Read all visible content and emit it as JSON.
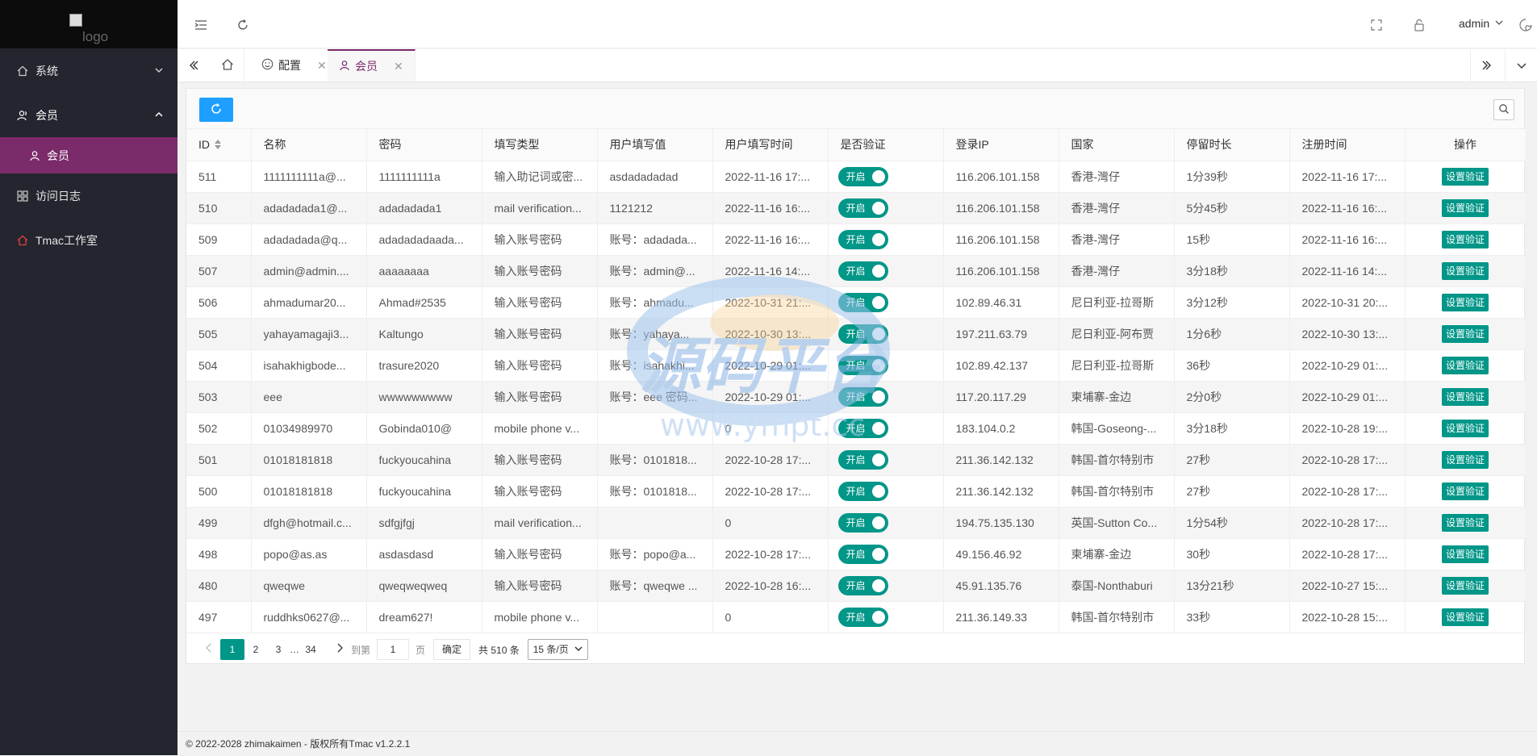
{
  "sidebar": {
    "logo_alt": "logo",
    "items": [
      {
        "label": "系统",
        "icon": "home-icon"
      },
      {
        "label": "会员",
        "icon": "user-group-icon"
      },
      {
        "label": "访问日志",
        "icon": "grid-icon"
      },
      {
        "label": "Tmac工作室",
        "icon": "home-icon"
      }
    ],
    "sub_items": [
      {
        "label": "会员",
        "icon": "user-icon"
      }
    ]
  },
  "header": {
    "user": "admin"
  },
  "tabs": [
    {
      "label": "配置"
    },
    {
      "label": "会员"
    }
  ],
  "table": {
    "columns": [
      "ID",
      "名称",
      "密码",
      "填写类型",
      "用户填写值",
      "用户填写时间",
      "是否验证",
      "登录IP",
      "国家",
      "停留时长",
      "注册时间",
      "操作"
    ],
    "switch_label": "开启",
    "action_label": "设置验证",
    "rows": [
      {
        "id": "511",
        "name": "1111111111a@...",
        "pwd": "1111111111a",
        "type": "输入助记词或密...",
        "value": "asdadadadad",
        "vtime": "2022-11-16 17:...",
        "ip": "116.206.101.158",
        "country": "香港-灣仔",
        "stay": "1分39秒",
        "reg": "2022-11-16 17:..."
      },
      {
        "id": "510",
        "name": "adadadada1@...",
        "pwd": "adadadada1",
        "type": "mail verification...",
        "value": "1121212",
        "vtime": "2022-11-16 16:...",
        "ip": "116.206.101.158",
        "country": "香港-灣仔",
        "stay": "5分45秒",
        "reg": "2022-11-16 16:..."
      },
      {
        "id": "509",
        "name": "adadadada@q...",
        "pwd": "adadadadaada...",
        "type": "输入账号密码",
        "value": "账号：adadada...",
        "vtime": "2022-11-16 16:...",
        "ip": "116.206.101.158",
        "country": "香港-灣仔",
        "stay": "15秒",
        "reg": "2022-11-16 16:..."
      },
      {
        "id": "507",
        "name": "admin@admin....",
        "pwd": "aaaaaaaa",
        "type": "输入账号密码",
        "value": "账号：admin@...",
        "vtime": "2022-11-16 14:...",
        "ip": "116.206.101.158",
        "country": "香港-灣仔",
        "stay": "3分18秒",
        "reg": "2022-11-16 14:..."
      },
      {
        "id": "506",
        "name": "ahmadumar20...",
        "pwd": "Ahmad#2535",
        "type": "输入账号密码",
        "value": "账号：ahmadu...",
        "vtime": "2022-10-31 21:...",
        "ip": "102.89.46.31",
        "country": "尼日利亚-拉哥斯",
        "stay": "3分12秒",
        "reg": "2022-10-31 20:..."
      },
      {
        "id": "505",
        "name": "yahayamagaji3...",
        "pwd": "Kaltungo",
        "type": "输入账号密码",
        "value": "账号：yahaya...",
        "vtime": "2022-10-30 13:...",
        "ip": "197.211.63.79",
        "country": "尼日利亚-阿布贾",
        "stay": "1分6秒",
        "reg": "2022-10-30 13:..."
      },
      {
        "id": "504",
        "name": "isahakhigbode...",
        "pwd": "trasure2020",
        "type": "输入账号密码",
        "value": "账号：isahakhi...",
        "vtime": "2022-10-29 01:...",
        "ip": "102.89.42.137",
        "country": "尼日利亚-拉哥斯",
        "stay": "36秒",
        "reg": "2022-10-29 01:..."
      },
      {
        "id": "503",
        "name": "eee",
        "pwd": "wwwwwwwww",
        "type": "输入账号密码",
        "value": "账号：eee 密码...",
        "vtime": "2022-10-29 01:...",
        "ip": "117.20.117.29",
        "country": "柬埔寨-金边",
        "stay": "2分0秒",
        "reg": "2022-10-29 01:..."
      },
      {
        "id": "502",
        "name": "01034989970",
        "pwd": "Gobinda010@",
        "type": "mobile phone v...",
        "value": "",
        "vtime": "0",
        "ip": "183.104.0.2",
        "country": "韩国-Goseong-...",
        "stay": "3分18秒",
        "reg": "2022-10-28 19:..."
      },
      {
        "id": "501",
        "name": "01018181818",
        "pwd": "fuckyoucahina",
        "type": "输入账号密码",
        "value": "账号：0101818...",
        "vtime": "2022-10-28 17:...",
        "ip": "211.36.142.132",
        "country": "韩国-首尔特别市",
        "stay": "27秒",
        "reg": "2022-10-28 17:..."
      },
      {
        "id": "500",
        "name": "01018181818",
        "pwd": "fuckyoucahina",
        "type": "输入账号密码",
        "value": "账号：0101818...",
        "vtime": "2022-10-28 17:...",
        "ip": "211.36.142.132",
        "country": "韩国-首尔特别市",
        "stay": "27秒",
        "reg": "2022-10-28 17:..."
      },
      {
        "id": "499",
        "name": "dfgh@hotmail.c...",
        "pwd": "sdfgjfgj",
        "type": "mail verification...",
        "value": "",
        "vtime": "0",
        "ip": "194.75.135.130",
        "country": "英国-Sutton Co...",
        "stay": "1分54秒",
        "reg": "2022-10-28 17:..."
      },
      {
        "id": "498",
        "name": "popo@as.as",
        "pwd": "asdasdasd",
        "type": "输入账号密码",
        "value": "账号：popo@a...",
        "vtime": "2022-10-28 17:...",
        "ip": "49.156.46.92",
        "country": "柬埔寨-金边",
        "stay": "30秒",
        "reg": "2022-10-28 17:..."
      },
      {
        "id": "480",
        "name": "qweqwe",
        "pwd": "qweqweqweq",
        "type": "输入账号密码",
        "value": "账号：qweqwe ...",
        "vtime": "2022-10-28 16:...",
        "ip": "45.91.135.76",
        "country": "泰国-Nonthaburi",
        "stay": "13分21秒",
        "reg": "2022-10-27 15:..."
      },
      {
        "id": "497",
        "name": "ruddhks0627@...",
        "pwd": "dream627!",
        "type": "mobile phone v...",
        "value": "",
        "vtime": "0",
        "ip": "211.36.149.33",
        "country": "韩国-首尔特别市",
        "stay": "33秒",
        "reg": "2022-10-28 15:..."
      }
    ]
  },
  "pager": {
    "pages": [
      "1",
      "2",
      "3",
      "…",
      "34"
    ],
    "goto_prefix": "到第",
    "goto_value": "1",
    "goto_suffix": "页",
    "confirm": "确定",
    "total": "共 510 条",
    "page_size": "15 条/页"
  },
  "watermark": {
    "title": "源码平台",
    "url": "www.ympt.cc"
  },
  "footer": {
    "text": "© 2022-2028 zhimakaimen - 版权所有Tmac v1.2.2.1"
  },
  "colors": {
    "accent": "#7b2a6a",
    "primary": "#009688",
    "blue": "#1e9fff",
    "sidebar": "#23262e"
  }
}
